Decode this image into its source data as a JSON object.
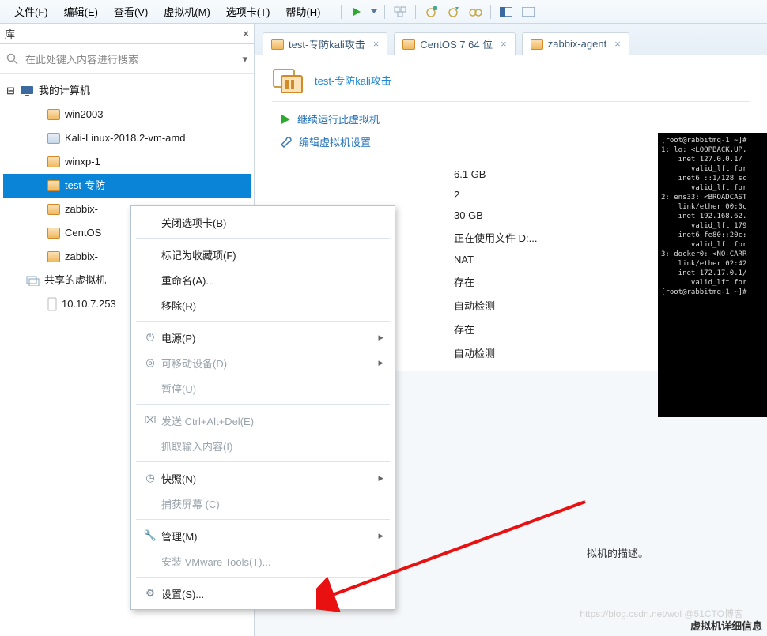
{
  "menubar": {
    "file": "文件(F)",
    "edit": "编辑(E)",
    "view": "查看(V)",
    "vm": "虚拟机(M)",
    "tabs": "选项卡(T)",
    "help": "帮助(H)"
  },
  "sidebar": {
    "title": "库",
    "close": "×",
    "search_placeholder": "在此处键入内容进行搜索",
    "tree": {
      "root": "我的计算机",
      "items": [
        "win2003",
        "Kali-Linux-2018.2-vm-amd",
        "winxp-1",
        "test-专防",
        "zabbix-",
        "CentOS",
        "zabbix-"
      ],
      "shared": "共享的虚拟机",
      "shared_ip": "10.10.7.253"
    }
  },
  "tabs": [
    {
      "label": "test-专防kali攻击"
    },
    {
      "label": "CentOS 7 64 位"
    },
    {
      "label": "zabbix-agent"
    }
  ],
  "vm_page": {
    "title": "test-专防kali攻击",
    "action_run": "继续运行此虚拟机",
    "action_edit": "编辑虚拟机设置",
    "values": [
      "6.1 GB",
      "2",
      "30 GB",
      "正在使用文件 D:...",
      "NAT",
      "存在",
      "自动检测",
      "存在",
      "自动检测"
    ],
    "partial_close_paren": ")",
    "description": "拟机的描述。"
  },
  "context_menu": {
    "close_tab": "关闭选项卡(B)",
    "favorite": "标记为收藏项(F)",
    "rename": "重命名(A)...",
    "remove": "移除(R)",
    "power": "电源(P)",
    "removable": "可移动设备(D)",
    "pause": "暂停(U)",
    "send_cad": "发送 Ctrl+Alt+Del(E)",
    "grab_input": "抓取输入内容(I)",
    "snapshot": "快照(N)",
    "capture": "捕获屏幕 (C)",
    "manage": "管理(M)",
    "install_tools": "安装 VMware Tools(T)...",
    "settings": "设置(S)..."
  },
  "terminal_preview": "[root@rabbitmq-1 ~]#\n1: lo: <LOOPBACK,UP,\n    inet 127.0.0.1/\n       valid_lft for\n    inet6 ::1/128 sc\n       valid_lft for\n2: ens33: <BROADCAST\n    link/ether 00:0c\n    inet 192.168.62.\n       valid_lft 179\n    inet6 fe80::20c:\n       valid_lft for\n3: docker0: <NO-CARR\n    link/ether 02:42\n    inet 172.17.0.1/\n       valid_lft for\n[root@rabbitmq-1 ~]#",
  "footer": "虚拟机详细信息",
  "watermark": "https://blog.csdn.net/wol @51CTO博客"
}
